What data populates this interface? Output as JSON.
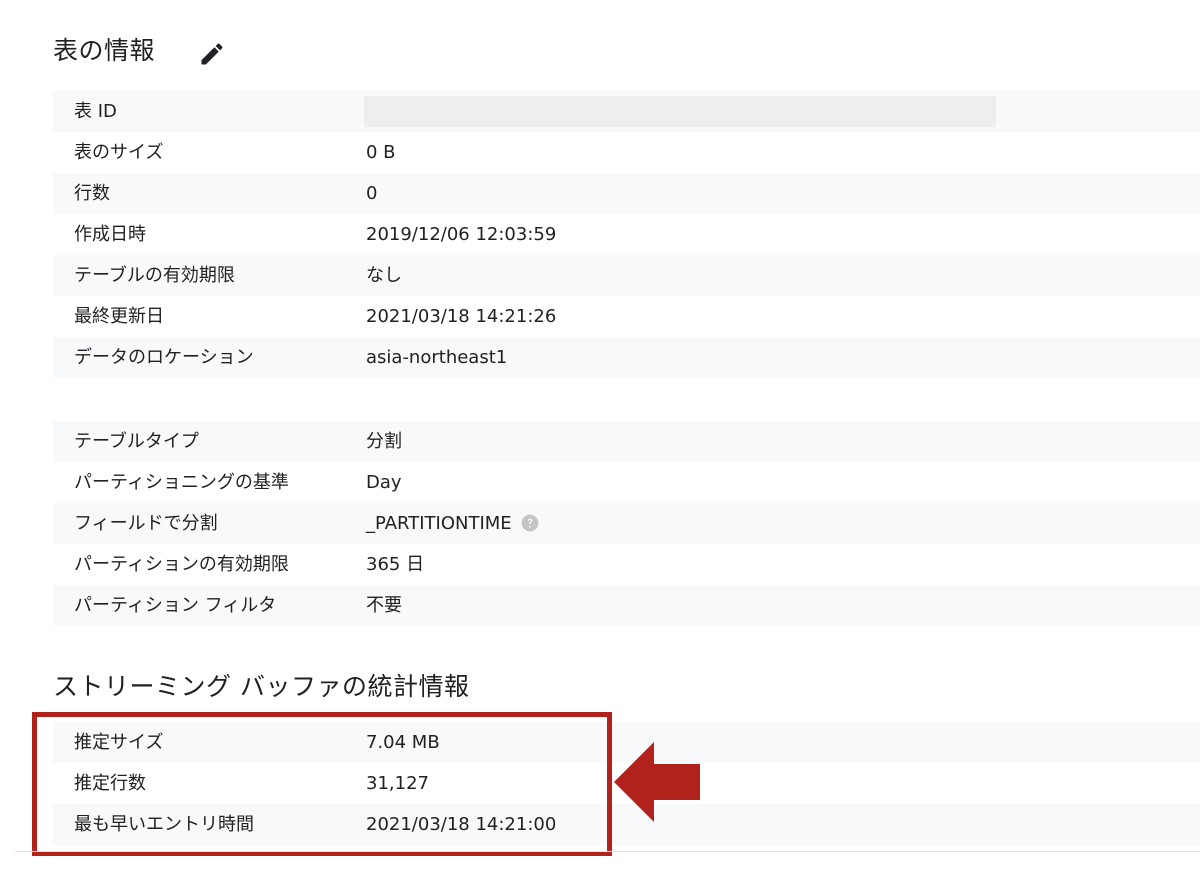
{
  "header": {
    "title": "表の情報",
    "edit_icon": "pencil-icon"
  },
  "table_info": {
    "rows": [
      {
        "label": "表 ID",
        "value": "",
        "redacted": true
      },
      {
        "label": "表のサイズ",
        "value": "0 B"
      },
      {
        "label": "行数",
        "value": "0"
      },
      {
        "label": "作成日時",
        "value": "2019/12/06 12:03:59"
      },
      {
        "label": "テーブルの有効期限",
        "value": "なし"
      },
      {
        "label": "最終更新日",
        "value": "2021/03/18 14:21:26"
      },
      {
        "label": "データのロケーション",
        "value": "asia-northeast1"
      }
    ]
  },
  "partition_info": {
    "rows": [
      {
        "label": "テーブルタイプ",
        "value": "分割"
      },
      {
        "label": "パーティショニングの基準",
        "value": "Day"
      },
      {
        "label": "フィールドで分割",
        "value": "_PARTITIONTIME",
        "help_icon": "help-circle-icon"
      },
      {
        "label": "パーティションの有効期限",
        "value": "365 日"
      },
      {
        "label": "パーティション フィルタ",
        "value": "不要"
      }
    ]
  },
  "streaming": {
    "title": "ストリーミング バッファの統計情報",
    "rows": [
      {
        "label": "推定サイズ",
        "value": "7.04 MB"
      },
      {
        "label": "推定行数",
        "value": "31,127"
      },
      {
        "label": "最も早いエントリ時間",
        "value": "2021/03/18 14:21:00"
      }
    ]
  },
  "annotation": {
    "highlight_color": "#b2221d",
    "arrow_icon": "left-arrow-icon"
  }
}
